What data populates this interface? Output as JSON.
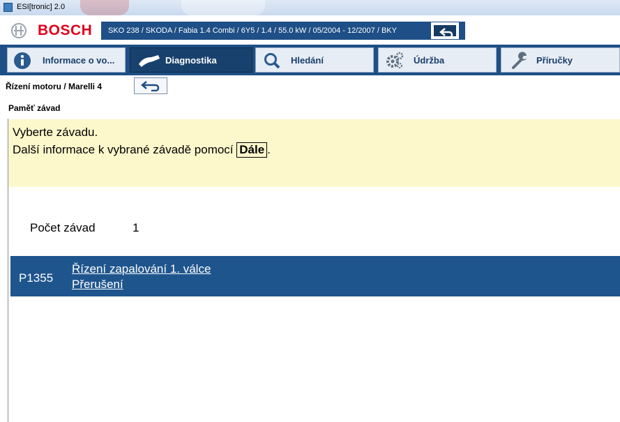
{
  "window": {
    "title": "ESI[tronic] 2.0"
  },
  "header": {
    "brand": "BOSCH",
    "vehicle": "SKO 238 / SKODA / Fabia 1.4 Combi / 6Y5 / 1.4 / 55.0 kW / 05/2004 - 12/2007 / BKY"
  },
  "tabs": [
    {
      "label": "Informace o vo...",
      "icon": "info-icon"
    },
    {
      "label": "Diagnostika",
      "icon": "diagnostic-plug-icon"
    },
    {
      "label": "Hledání",
      "icon": "search-icon"
    },
    {
      "label": "Údržba",
      "icon": "gears-icon"
    },
    {
      "label": "Příručky",
      "icon": "wrench-icon"
    }
  ],
  "breadcrumb": "Řízení motoru / Marelli 4",
  "section_title": "Paměť závad",
  "hint": {
    "line1": "Vyberte závadu.",
    "line2_prefix": "Další informace k vybrané závadě pomocí",
    "line2_key": "Dále",
    "line2_suffix": "."
  },
  "fault_count": {
    "label": "Počet závad",
    "value": "1"
  },
  "faults": [
    {
      "code": "P1355",
      "line1": "Řízení zapalování 1. válce",
      "line2": "Přerušení"
    }
  ],
  "colors": {
    "accent": "#1e4f86",
    "hint_bg": "#fdf8cc",
    "brand": "#e0001b",
    "selected_row": "#1f558d"
  }
}
